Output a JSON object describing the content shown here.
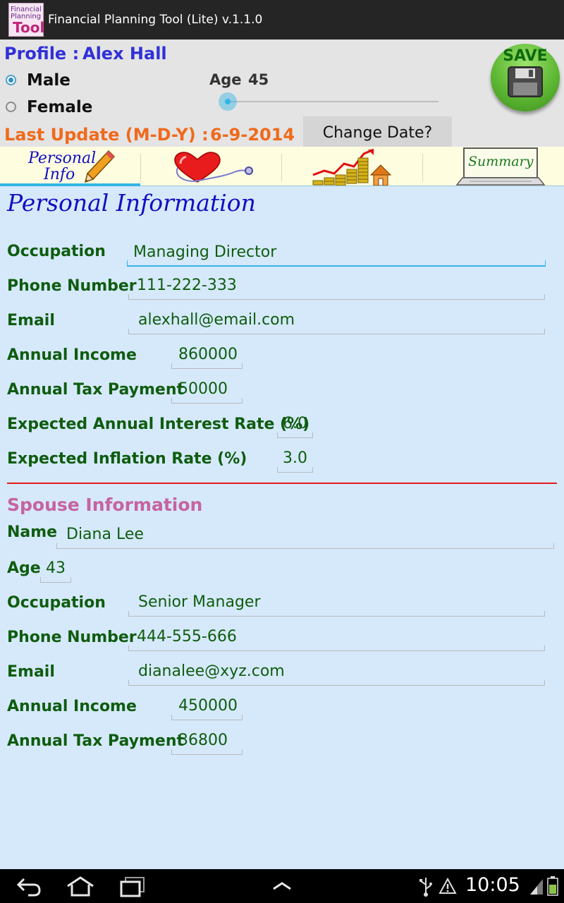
{
  "app": {
    "title": "Financial Planning Tool (Lite)   v.1.1.0",
    "icon_text": [
      "Financial",
      "Planning",
      "Tool"
    ]
  },
  "profile": {
    "label": "Profile :",
    "name": "Alex Hall",
    "gender_options": [
      {
        "label": "Male",
        "selected": true
      },
      {
        "label": "Female",
        "selected": false
      }
    ],
    "age_label": "Age",
    "age_value": "45",
    "last_update_label": "Last Update (M-D-Y) :",
    "last_update_value": "6-9-2014",
    "change_date_label": "Change Date?",
    "save_label": "SAVE"
  },
  "tabs": [
    {
      "id": "personal-info",
      "label_lines": [
        "Personal",
        "Info"
      ],
      "icon": "pencil-icon",
      "selected": true
    },
    {
      "id": "health",
      "icon": "heart-stethoscope-icon",
      "selected": false
    },
    {
      "id": "finance",
      "icon": "coins-house-chart-icon",
      "selected": false
    },
    {
      "id": "summary",
      "label": "Summary",
      "icon": "laptop-icon",
      "selected": false
    }
  ],
  "personal": {
    "title": "Personal Information",
    "fields": [
      {
        "label": "Occupation",
        "value": "Managing Director"
      },
      {
        "label": "Phone Number",
        "value": "111-222-333"
      },
      {
        "label": "Email",
        "value": "alexhall@email.com"
      },
      {
        "label": "Annual Income",
        "value": "860000"
      },
      {
        "label": "Annual Tax Payment",
        "value": "50000"
      },
      {
        "label": "Expected Annual Interest Rate (%)",
        "value": "6.0"
      },
      {
        "label": "Expected Inflation Rate (%)",
        "value": "3.0"
      }
    ]
  },
  "spouse": {
    "title": "Spouse Information",
    "fields": [
      {
        "label": "Name",
        "value": "Diana Lee"
      },
      {
        "label": "Age",
        "value": "43"
      },
      {
        "label": "Occupation",
        "value": "Senior Manager"
      },
      {
        "label": "Phone Number",
        "value": "444-555-666"
      },
      {
        "label": "Email",
        "value": "dianalee@xyz.com"
      },
      {
        "label": "Annual Income",
        "value": "450000"
      },
      {
        "label": "Annual Tax Payment",
        "value": "36800"
      }
    ]
  },
  "statusbar": {
    "time": "10:05",
    "icons": [
      "usb-icon",
      "warning-icon",
      "signal-icon",
      "battery-icon"
    ]
  },
  "navbar": {
    "icons": [
      "back-icon",
      "home-icon",
      "recent-apps-icon",
      "up-chevron-icon"
    ]
  },
  "colors": {
    "profile_blue": "#3030d8",
    "update_orange": "#f06a1c",
    "field_green": "#0f5c0f",
    "spouse_pink": "#c663a0",
    "divider_red": "#e21b1b",
    "focus_blue": "#33b5e5",
    "content_bg": "#d6e9fb"
  }
}
